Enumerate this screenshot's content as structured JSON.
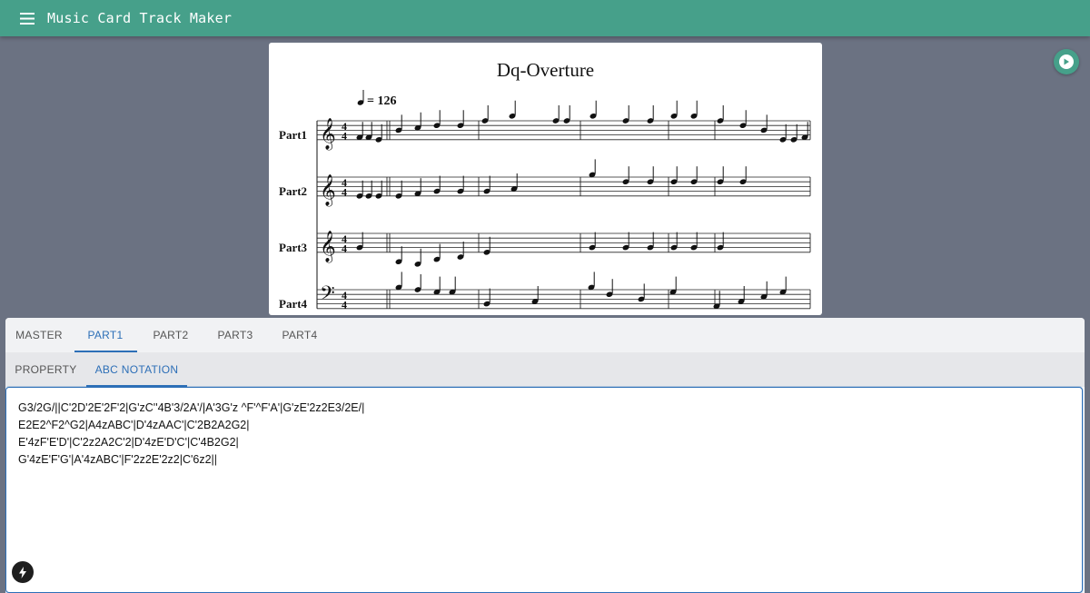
{
  "app": {
    "title": "Music Card Track Maker"
  },
  "score": {
    "title": "Dq-Overture",
    "tempo": "= 126",
    "parts": [
      "Part1",
      "Part2",
      "Part3",
      "Part4"
    ]
  },
  "tabs": {
    "main": [
      "MASTER",
      "PART1",
      "PART2",
      "PART3",
      "PART4"
    ],
    "main_active": "PART1",
    "sub": [
      "PROPERTY",
      "ABC NOTATION"
    ],
    "sub_active": "ABC NOTATION"
  },
  "editor": {
    "lines": [
      "G3/2G/||C'2D'2E'2F'2|G'zC''4B'3/2A'/|A'3G'z ^F'^F'A'|G'zE'2z2E3/2E/|",
      "E2E2^F2^G2|A4zABC'|D'4zAAC'|C'2B2A2G2|",
      "E'4zF'E'D'|C'2z2A2C'2|D'4zE'D'C'|C'4B2G2|",
      "G'4zE'F'G'|A'4zABC'|F'2z2E'2z2|C'6z2||"
    ]
  },
  "colors": {
    "appbar": "#46a08a",
    "background": "#6b7282",
    "accent": "#2d6fb7"
  },
  "icons": {
    "menu": "menu-icon",
    "play": "play-icon",
    "bolt": "bolt-icon"
  }
}
